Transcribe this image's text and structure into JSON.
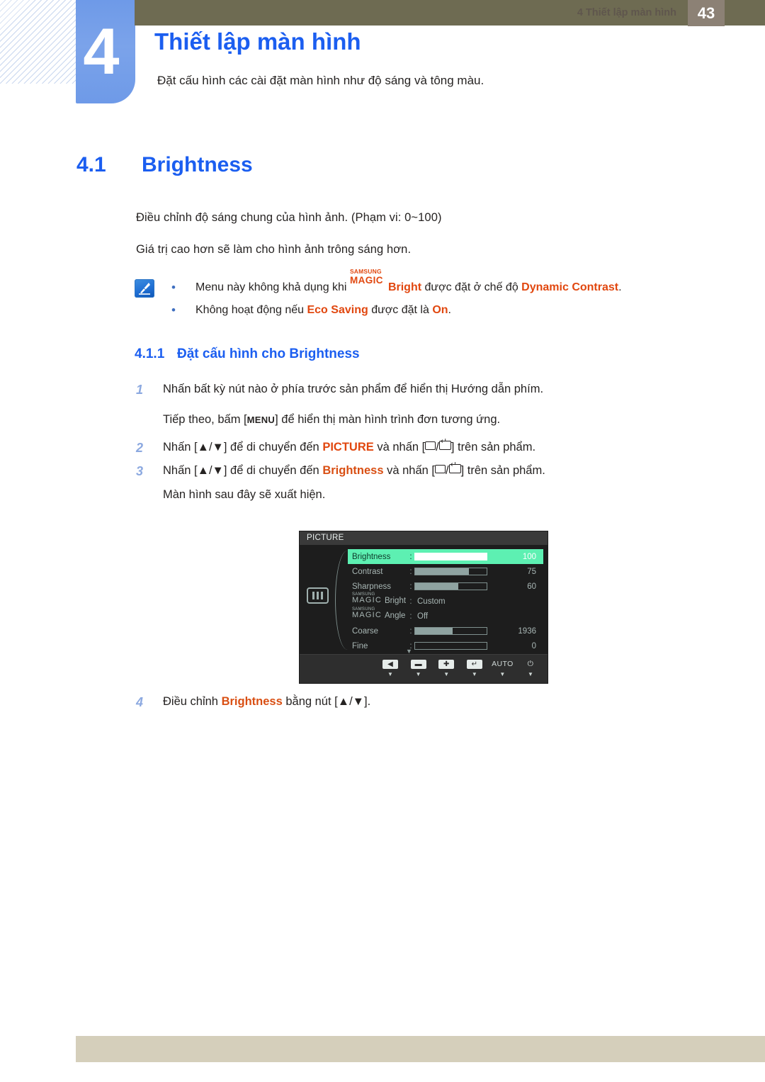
{
  "header": {
    "chapter_number": "4",
    "chapter_title": "Thiết lập màn hình",
    "chapter_subtitle": "Đặt cấu hình các cài đặt màn hình như độ sáng và tông màu."
  },
  "section": {
    "number": "4.1",
    "title": "Brightness",
    "paragraph_1": "Điều chỉnh độ sáng chung của hình ảnh. (Phạm vi: 0~100)",
    "paragraph_2": "Giá trị cao hơn sẽ làm cho hình ảnh trông sáng hơn."
  },
  "note": {
    "icon": "note-pen-icon",
    "bullet_1": {
      "before": "Menu này không khả dụng khi",
      "magic_top": "SAMSUNG",
      "magic_bottom": "MAGIC",
      "magic_suffix": "Bright",
      "middle": "được đặt ở chế độ",
      "highlight": "Dynamic Contrast",
      "after": "."
    },
    "bullet_2": {
      "before": "Không hoạt động nếu",
      "highlight_1": "Eco Saving",
      "middle": "được đặt là",
      "highlight_2": "On",
      "after": "."
    }
  },
  "subsection": {
    "number": "4.1.1",
    "title": "Đặt cấu hình cho Brightness"
  },
  "steps": {
    "s1_index": "1",
    "s1_text": "Nhấn bất kỳ nút nào ở phía trước sản phẩm để hiển thị Hướng dẫn phím.",
    "s1b_before": "Tiếp theo, bấm [",
    "s1b_key": "MENU",
    "s1b_after": "] để hiển thị màn hình trình đơn tương ứng.",
    "s2_index": "2",
    "s2_a": "Nhấn [▲/▼] để di chuyển đến",
    "s2_target": "PICTURE",
    "s2_b": "và nhấn [",
    "s2_c": "] trên sản phẩm.",
    "s3_index": "3",
    "s3_a": "Nhấn [▲/▼] để di chuyển đến",
    "s3_target": "Brightness",
    "s3_b": "và nhấn [",
    "s3_c": "] trên sản phẩm.",
    "s3b_text": "Màn hình sau đây sẽ xuất hiện.",
    "s4_index": "4",
    "s4_a": "Điều chỉnh",
    "s4_target": "Brightness",
    "s4_b": "bằng nút [▲/▼]."
  },
  "osd": {
    "title": "PICTURE",
    "left_icon": "picture-bars-icon",
    "scroll_indicator": "▼",
    "rows": [
      {
        "label": "Brightness",
        "colon": ":",
        "value": "100",
        "fill_pct": 100,
        "selected": true,
        "type": "slider"
      },
      {
        "label": "Contrast",
        "colon": ":",
        "value": "75",
        "fill_pct": 75,
        "selected": false,
        "type": "slider"
      },
      {
        "label": "Sharpness",
        "colon": ":",
        "value": "60",
        "fill_pct": 60,
        "selected": false,
        "type": "slider"
      },
      {
        "label": "Bright",
        "colon": ":",
        "value": "Custom",
        "selected": false,
        "type": "text",
        "magic_top": "SAMSUNG",
        "magic_bottom": "MAGIC"
      },
      {
        "label": "Angle",
        "colon": ":",
        "value": "Off",
        "selected": false,
        "type": "text",
        "magic_top": "SAMSUNG",
        "magic_bottom": "MAGIC"
      },
      {
        "label": "Coarse",
        "colon": ":",
        "value": "1936",
        "fill_pct": 52,
        "selected": false,
        "type": "slider"
      },
      {
        "label": "Fine",
        "colon": ":",
        "value": "0",
        "fill_pct": 0,
        "selected": false,
        "type": "slider"
      }
    ],
    "buttons": [
      {
        "icon": "left-arrow-icon",
        "glyph": "◀",
        "sub": "▼",
        "plain": false
      },
      {
        "icon": "minus-icon",
        "glyph": "▬",
        "sub": "▼",
        "plain": false
      },
      {
        "icon": "plus-icon",
        "glyph": "✚",
        "sub": "▼",
        "plain": false
      },
      {
        "icon": "enter-icon",
        "glyph": "↵",
        "sub": "▼",
        "plain": false
      },
      {
        "icon": "auto-button",
        "glyph": "AUTO",
        "sub": "▼",
        "plain": true
      },
      {
        "icon": "power-icon",
        "glyph": "⏻",
        "sub": "▼",
        "plain": true
      }
    ]
  },
  "footer": {
    "text": "4 Thiết lập màn hình",
    "page_number": "43"
  },
  "colors": {
    "accent_blue": "#1b5ef0",
    "tab_blue": "#7ba3ea",
    "olive": "#6e6b52",
    "orange": "#e1470f",
    "osd_highlight": "#5df0b2",
    "footer_band": "#d5cfbb",
    "page_box": "#8c8175"
  }
}
